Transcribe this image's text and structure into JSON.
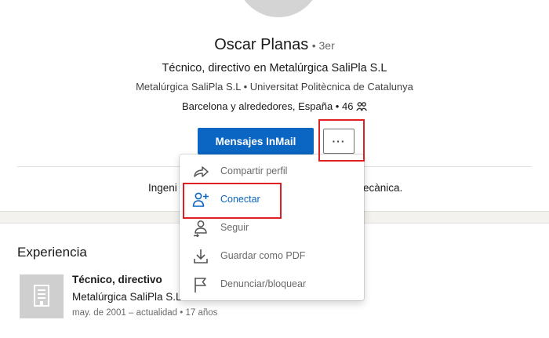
{
  "profile": {
    "name": "Oscar Planas",
    "degree": "• 3er",
    "headline": "Técnico, directivo en Metalúrgica SaliPla S.L",
    "org_line": "Metalúrgica SaliPla S.L • Universitat Politècnica de Catalunya",
    "location_text": "Barcelona y alrededores, España • 46",
    "connections_icon": "people-icon",
    "about_left": "Ingeni",
    "about_right": "ecànica."
  },
  "actions": {
    "inmail_label": "Mensajes InMail",
    "more_label": "···"
  },
  "menu": {
    "items": [
      {
        "label": "Compartir perfil",
        "icon": "share-arrow-icon"
      },
      {
        "label": "Conectar",
        "icon": "add-person-icon"
      },
      {
        "label": "Seguir",
        "icon": "follow-person-icon"
      },
      {
        "label": "Guardar como PDF",
        "icon": "download-icon"
      },
      {
        "label": "Denunciar/bloquear",
        "icon": "flag-icon"
      }
    ]
  },
  "experience": {
    "section_title": "Experiencia",
    "items": [
      {
        "title": "Técnico, directivo",
        "company": "Metalúrgica SaliPla S.L",
        "dates": "may. de 2001 – actualidad • 17 años",
        "logo_icon": "building-icon"
      }
    ]
  },
  "colors": {
    "primary": "#0a66c2",
    "highlight": "#e02020",
    "background": "#f3f2ef"
  }
}
